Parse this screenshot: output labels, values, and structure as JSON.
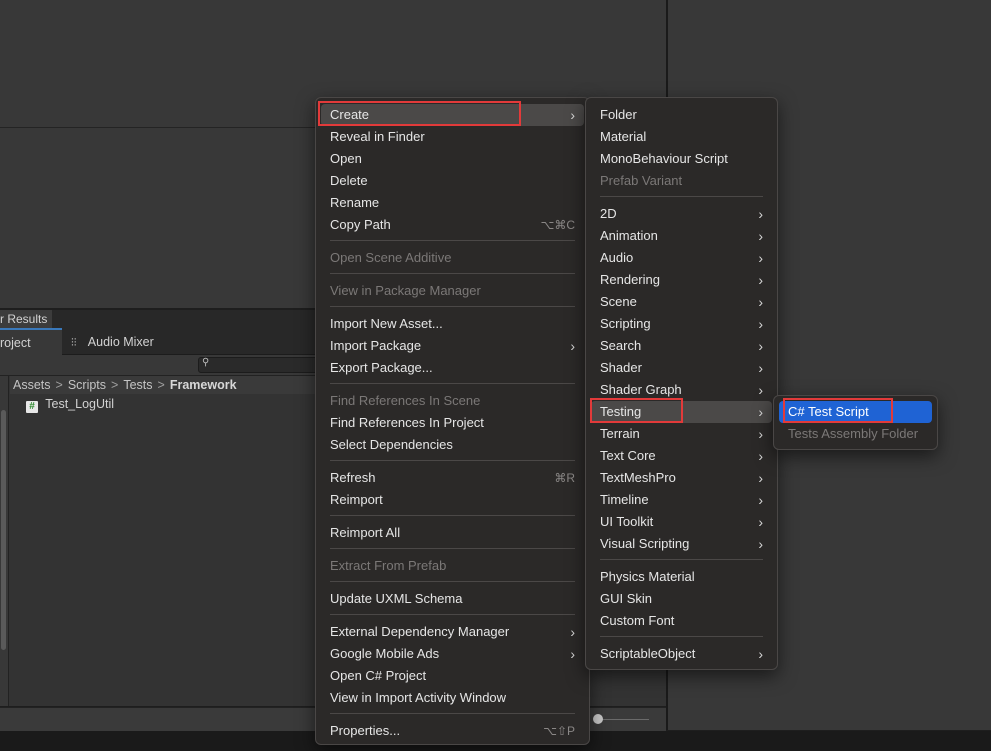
{
  "window": {
    "results_tab": "r Results",
    "tabs": [
      {
        "label": "roject",
        "active": true
      },
      {
        "label": "Audio Mixer",
        "active": false
      }
    ],
    "breadcrumb": [
      "Assets",
      "Scripts",
      "Tests",
      "Framework"
    ],
    "breadcrumb_separator": ">",
    "files": [
      {
        "name": "Test_LogUtil",
        "icon": "csharp-script-icon"
      }
    ]
  },
  "icons": {
    "file_icon_glyph": "#",
    "search_glyph": "⚲",
    "mixer_glyph": "⫶⫶",
    "submenu_arrow": "›"
  },
  "colors": {
    "menu_bg": "#2b2928",
    "highlight_bg": "#4b4948",
    "selection_blue": "#1f63d4",
    "annotation_red": "#e23a3a",
    "tab_accent": "#3a79bb"
  },
  "context_menu": {
    "items": [
      {
        "label": "Create",
        "submenu": true,
        "highlighted": true
      },
      {
        "label": "Reveal in Finder"
      },
      {
        "label": "Open"
      },
      {
        "label": "Delete"
      },
      {
        "label": "Rename"
      },
      {
        "label": "Copy Path",
        "shortcut": "⌥⌘C"
      },
      {
        "label": "Open Scene Additive",
        "disabled": true
      },
      {
        "label": "View in Package Manager",
        "disabled": true
      },
      {
        "label": "Import New Asset..."
      },
      {
        "label": "Import Package",
        "submenu": true
      },
      {
        "label": "Export Package..."
      },
      {
        "label": "Find References In Scene",
        "disabled": true
      },
      {
        "label": "Find References In Project"
      },
      {
        "label": "Select Dependencies"
      },
      {
        "label": "Refresh",
        "shortcut": "⌘R"
      },
      {
        "label": "Reimport"
      },
      {
        "label": "Reimport All"
      },
      {
        "label": "Extract From Prefab",
        "disabled": true
      },
      {
        "label": "Update UXML Schema"
      },
      {
        "label": "External Dependency Manager",
        "submenu": true
      },
      {
        "label": "Google Mobile Ads",
        "submenu": true
      },
      {
        "label": "Open C# Project"
      },
      {
        "label": "View in Import Activity Window"
      },
      {
        "label": "Properties...",
        "shortcut": "⌥⇧P"
      }
    ]
  },
  "create_menu": {
    "items": [
      {
        "label": "Folder"
      },
      {
        "label": "Material"
      },
      {
        "label": "MonoBehaviour Script"
      },
      {
        "label": "Prefab Variant",
        "disabled": true
      },
      {
        "label": "2D",
        "submenu": true
      },
      {
        "label": "Animation",
        "submenu": true
      },
      {
        "label": "Audio",
        "submenu": true
      },
      {
        "label": "Rendering",
        "submenu": true
      },
      {
        "label": "Scene",
        "submenu": true
      },
      {
        "label": "Scripting",
        "submenu": true
      },
      {
        "label": "Search",
        "submenu": true
      },
      {
        "label": "Shader",
        "submenu": true
      },
      {
        "label": "Shader Graph",
        "submenu": true
      },
      {
        "label": "Testing",
        "submenu": true,
        "highlighted": true
      },
      {
        "label": "Terrain",
        "submenu": true
      },
      {
        "label": "Text Core",
        "submenu": true
      },
      {
        "label": "TextMeshPro",
        "submenu": true
      },
      {
        "label": "Timeline",
        "submenu": true
      },
      {
        "label": "UI Toolkit",
        "submenu": true
      },
      {
        "label": "Visual Scripting",
        "submenu": true
      },
      {
        "label": "Physics Material"
      },
      {
        "label": "GUI Skin"
      },
      {
        "label": "Custom Font"
      },
      {
        "label": "ScriptableObject",
        "submenu": true
      }
    ]
  },
  "testing_menu": {
    "items": [
      {
        "label": "C# Test Script",
        "selected": true
      },
      {
        "label": "Tests Assembly Folder",
        "disabled": true
      }
    ]
  }
}
